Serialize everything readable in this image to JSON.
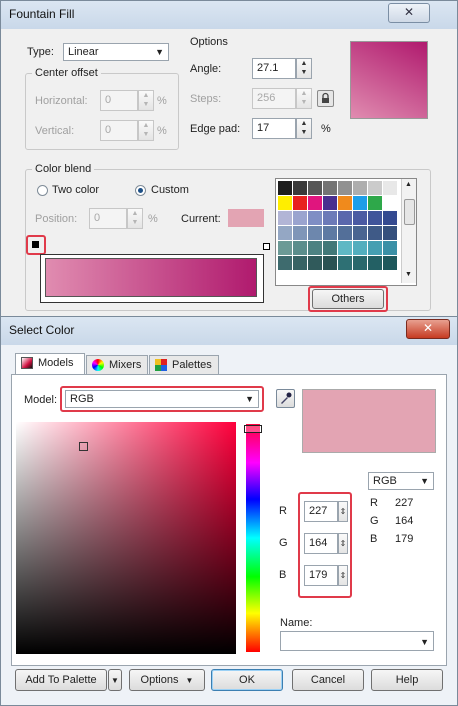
{
  "fountain": {
    "title": "Fountain Fill",
    "type_label": "Type:",
    "type_value": "Linear",
    "center_offset_label": "Center offset",
    "horizontal_label": "Horizontal:",
    "horizontal_value": "0",
    "vertical_label": "Vertical:",
    "vertical_value": "0",
    "percent": "%",
    "options_label": "Options",
    "angle_label": "Angle:",
    "angle_value": "27.1",
    "steps_label": "Steps:",
    "steps_value": "256",
    "edge_pad_label": "Edge pad:",
    "edge_pad_value": "17",
    "color_blend_label": "Color blend",
    "two_color_label": "Two color",
    "custom_label": "Custom",
    "position_label": "Position:",
    "position_value": "0",
    "current_label": "Current:",
    "others_label": "Others",
    "close_glyph": "✕",
    "current_color": "#e3a4b3",
    "preview_from": "#e08cb0",
    "preview_to": "#b01a6e"
  },
  "select_color": {
    "title": "Select Color",
    "tabs": [
      "Models",
      "Mixers",
      "Palettes"
    ],
    "model_label": "Model:",
    "model_value": "RGB",
    "mode_value": "RGB",
    "channels": [
      {
        "label": "R",
        "value": "227"
      },
      {
        "label": "G",
        "value": "164"
      },
      {
        "label": "B",
        "value": "179"
      }
    ],
    "readout": [
      {
        "label": "R",
        "value": "227"
      },
      {
        "label": "G",
        "value": "164"
      },
      {
        "label": "B",
        "value": "179"
      }
    ],
    "name_label": "Name:",
    "name_value": "",
    "swatch_color": "#e3a4b3",
    "hue_color": "#ff003c",
    "buttons": {
      "add_to_palette": "Add To Palette",
      "options": "Options",
      "ok": "OK",
      "cancel": "Cancel",
      "help": "Help"
    },
    "close_glyph": "✕"
  },
  "palette_colors": [
    "#1e1e1e",
    "#3a3a3a",
    "#575757",
    "#747474",
    "#919191",
    "#aeaeae",
    "#cbcbcb",
    "#e8e8e8",
    "#ffee00",
    "#e8221e",
    "#e0157e",
    "#4a2f8f",
    "#f08a1c",
    "#1d9ee8",
    "#2ea84a",
    "#ffffff",
    "#b2b5d6",
    "#9aa4cf",
    "#7f8ec4",
    "#6c7ab8",
    "#5a67ac",
    "#4b5aa3",
    "#40549a",
    "#344a90",
    "#94a7c4",
    "#7f96b8",
    "#6d87ad",
    "#5e7aa3",
    "#536f99",
    "#4a6591",
    "#3f5a87",
    "#35507d",
    "#6c9a96",
    "#5b8e8c",
    "#4d8282",
    "#417878",
    "#5fb8c4",
    "#52aebe",
    "#459fb2",
    "#3a90a6",
    "#3e6b6e",
    "#376364",
    "#305a5b",
    "#2a5253",
    "#2e7074",
    "#29686c",
    "#236064",
    "#1e585c"
  ]
}
